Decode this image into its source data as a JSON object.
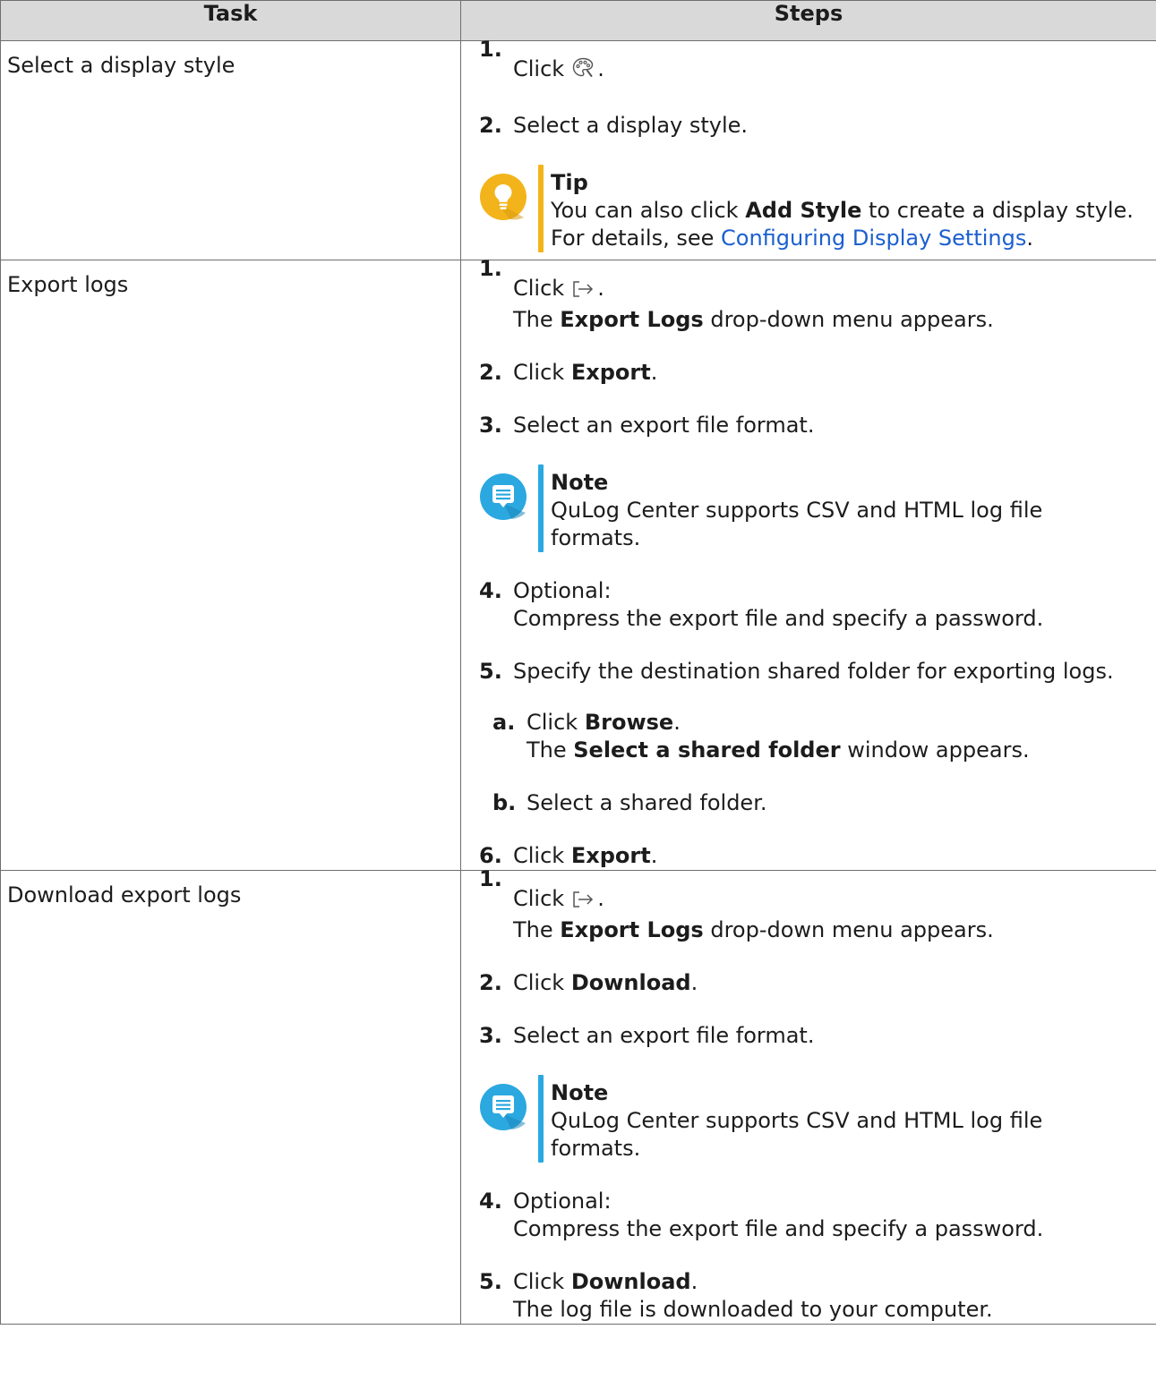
{
  "header": {
    "task": "Task",
    "steps": "Steps"
  },
  "colors": {
    "tip": "#f3b41b",
    "note": "#2ba8e0",
    "link": "#1b5fcf",
    "header_bg": "#d9d9d9"
  },
  "rows": [
    {
      "task": "Select a display style",
      "steps": [
        {
          "num": "1.",
          "click": "Click",
          "icon": "palette-icon",
          "tail": "."
        },
        {
          "num": "2.",
          "text": "Select a display style."
        }
      ],
      "tip": {
        "icon": "lightbulb-icon",
        "title": "Tip",
        "pre": "You can also click ",
        "bold": "Add Style",
        "post": " to create a display style.",
        "line2_pre": "For details, see ",
        "link": "Configuring Display Settings",
        "line2_post": "."
      }
    },
    {
      "task": "Export logs",
      "step1": {
        "num": "1.",
        "click": "Click",
        "icon": "export-icon",
        "tail": ".",
        "l2_pre": "The ",
        "l2_bold": "Export Logs",
        "l2_post": " drop-down menu appears."
      },
      "step2": {
        "num": "2.",
        "pre": "Click ",
        "bold": "Export",
        "post": "."
      },
      "step3": {
        "num": "3.",
        "text": "Select an export file format."
      },
      "note": {
        "icon": "note-icon",
        "title": "Note",
        "text": "QuLog Center supports CSV and HTML log file formats."
      },
      "step4": {
        "num": "4.",
        "line1": "Optional:",
        "line2": "Compress the export file and specify a password."
      },
      "step5": {
        "num": "5.",
        "text": "Specify the destination shared folder for exporting logs."
      },
      "sub_a": {
        "num": "a.",
        "pre": "Click ",
        "bold": "Browse",
        "post": ".",
        "l2_pre": "The ",
        "l2_bold": "Select a shared folder",
        "l2_post": " window appears."
      },
      "sub_b": {
        "num": "b.",
        "text": "Select a shared folder."
      },
      "step6": {
        "num": "6.",
        "pre": "Click ",
        "bold": "Export",
        "post": "."
      }
    },
    {
      "task": "Download export logs",
      "step1": {
        "num": "1.",
        "click": "Click",
        "icon": "export-icon",
        "tail": ".",
        "l2_pre": "The ",
        "l2_bold": "Export Logs",
        "l2_post": " drop-down menu appears."
      },
      "step2": {
        "num": "2.",
        "pre": "Click ",
        "bold": "Download",
        "post": "."
      },
      "step3": {
        "num": "3.",
        "text": "Select an export file format."
      },
      "note": {
        "icon": "note-icon",
        "title": "Note",
        "text": "QuLog Center supports CSV and HTML log file formats."
      },
      "step4": {
        "num": "4.",
        "line1": "Optional:",
        "line2": "Compress the export file and specify a password."
      },
      "step5": {
        "num": "5.",
        "pre": "Click ",
        "bold": "Download",
        "post": ".",
        "line2": "The log file is downloaded to your computer."
      }
    }
  ]
}
